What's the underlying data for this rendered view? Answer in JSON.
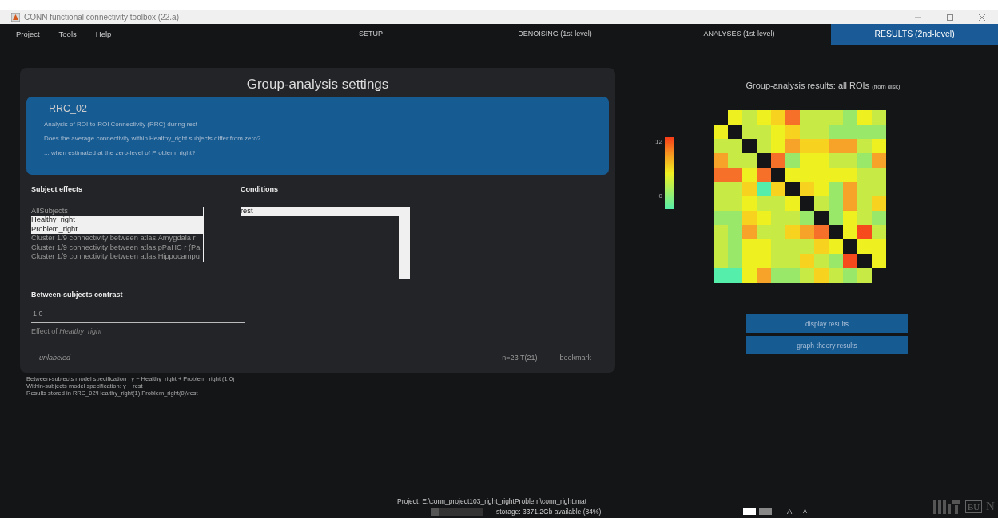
{
  "window": {
    "title": "CONN functional connectivity toolbox (22.a)"
  },
  "menu": [
    "Project",
    "Tools",
    "Help"
  ],
  "tabs": [
    {
      "label": "SETUP",
      "selected": false
    },
    {
      "label": "DENOISING (1st-level)",
      "selected": false
    },
    {
      "label": "ANALYSES (1st-level)",
      "selected": false
    },
    {
      "label": "RESULTS (2nd-level)",
      "selected": true
    }
  ],
  "settings": {
    "title": "Group-analysis settings",
    "analysis": {
      "name": "RRC_02",
      "lines": [
        "Analysis of ROI-to-ROI Connectivity (RRC) during rest",
        "Does the average connectivity within Healthy_right subjects differ from zero?",
        "... when estimated at the zero-level of Problem_right?"
      ]
    },
    "subject_effects": {
      "label": "Subject effects",
      "items": [
        {
          "label": "AllSubjects",
          "selected": false
        },
        {
          "label": "Healthy_right",
          "selected": true
        },
        {
          "label": "Problem_right",
          "selected": true
        },
        {
          "label": "Cluster 1/9 connectivity between atlas.Amygdala r",
          "selected": false
        },
        {
          "label": "Cluster 1/9 connectivity between atlas.pPaHC r (Pa",
          "selected": false
        },
        {
          "label": "Cluster 1/9 connectivity between atlas.Hippocampu",
          "selected": false
        }
      ]
    },
    "conditions": {
      "label": "Conditions",
      "items": [
        {
          "label": "rest",
          "selected": true
        }
      ]
    },
    "contrast": {
      "label": "Between-subjects contrast",
      "value": "1 0",
      "effect": "Effect of *Healthy_right*"
    },
    "footer": {
      "label": "unlabeled",
      "stats": "n=23 T(21)",
      "bookmark": "bookmark"
    }
  },
  "model_notes": [
    "Between-subjects model specification : y ~ Healthy_right + Problem_right  (1 0)",
    "Within-subjects model specification: y ~ rest",
    "Results stored in RRC_02\\Healthy_right(1).Problem_right(0)\\rest"
  ],
  "results": {
    "title": "Group-analysis results: all ROIs",
    "title_note": "(from disk)",
    "colorbar": {
      "max": "12",
      "min": "0"
    },
    "buttons": [
      "display results",
      "graph-theory results"
    ]
  },
  "status": {
    "project": "Project: E:\\conn_project103_right_rightProblem\\conn_right.mat",
    "storage": "storage: 3371.2Gb available (84%)",
    "storage_meter": {
      "level": 0.16
    }
  },
  "font_buttons": [
    "A",
    "A"
  ],
  "logos": {
    "bu": "BU",
    "n": "N"
  }
}
